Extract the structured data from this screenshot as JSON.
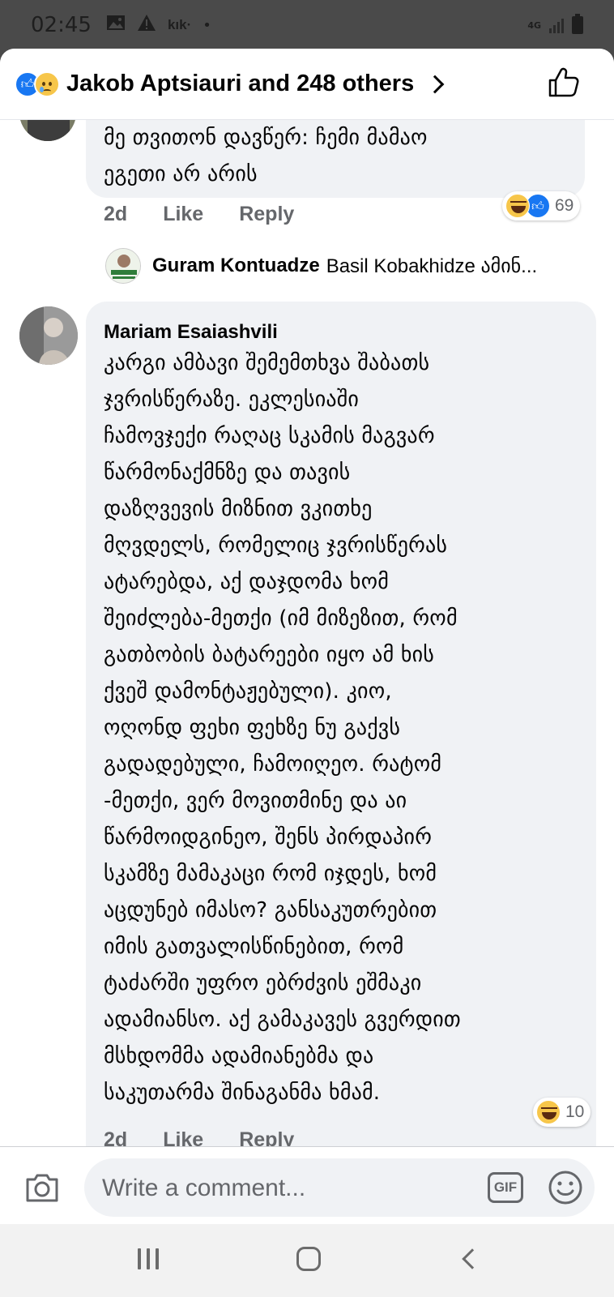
{
  "status_bar": {
    "time": "02:45",
    "kik": "kık·",
    "dot": "•",
    "network": "4G"
  },
  "header": {
    "title": "Jakob Aptsiauri and 248 others"
  },
  "comments": [
    {
      "text_lines": [
        "მე თვითონ დავწერ: ჩემი მამაო",
        "ეგეთი არ არის"
      ],
      "time": "2d",
      "like_label": "Like",
      "reply_label": "Reply",
      "reaction_count": "69"
    },
    {
      "author": "Mariam Esaiashvili",
      "text_lines": [
        "კარგი ამბავი შემემთხვა შაბათს",
        "ჯვრისწერაზე. ეკლესიაში",
        "ჩამოვჯექი რაღაც სკამის მაგვარ",
        "წარმონაქმნზე და თავის",
        "დაზღვევის მიზნით ვკითხე",
        "მღვდელს, რომელიც ჯვრისწერას",
        "ატარებდა, აქ დაჯდომა ხომ",
        "შეიძლება-მეთქი (იმ მიზეზით, რომ",
        "გათბობის ბატარეები იყო ამ ხის",
        "ქვეშ დამონტაჟებული). კიო,",
        "ოღონდ ფეხი ფეხზე ნუ გაქვს",
        "გადადებული, ჩამოიღეო. რატომ",
        "-მეთქი, ვერ მოვითმინე და აი",
        "წარმოიდგინეო, შენს პირდაპირ",
        "სკამზე მამაკაცი რომ იჯდეს, ხომ",
        "აცდუნებ იმასო? განსაკუთრებით",
        "იმის გათვალისწინებით, რომ",
        "ტაძარში უფრო ებრძვის ეშმაკი",
        "ადამიანსო. აქ გამაკავეს გვერდით",
        "მსხდომმა ადამიანებმა და",
        "საკუთარმა შინაგანმა ხმამ."
      ],
      "time": "2d",
      "like_label": "Like",
      "reply_label": "Reply",
      "reaction_count": "10"
    }
  ],
  "reply_preview": {
    "author": "Guram Kontuadze",
    "text": "Basil Kobakhidze ამინ..."
  },
  "composer": {
    "placeholder": "Write a comment...",
    "gif_label": "GIF"
  },
  "colors": {
    "accent": "#1877f2",
    "bubble": "#f0f2f5",
    "secondary_text": "#65676b"
  }
}
